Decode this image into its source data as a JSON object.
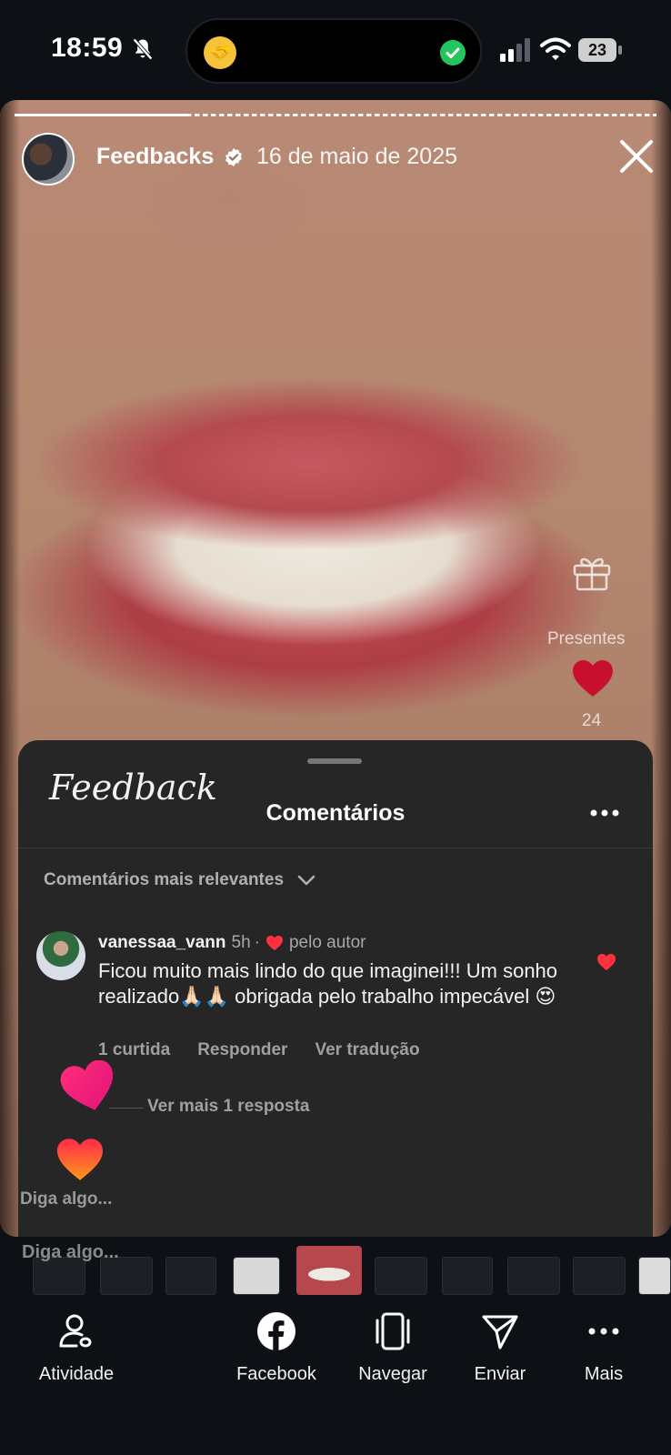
{
  "status_bar": {
    "time": "18:59",
    "battery": "23",
    "icons": [
      "bell-muted-icon",
      "handshake-emoji-icon",
      "check-circle-icon",
      "signal-icon",
      "wifi-icon",
      "battery-icon"
    ]
  },
  "story": {
    "account_name": "Feedbacks",
    "date": "16 de maio de 2025",
    "progress_fraction": 0.27,
    "gifts_label": "Presentes",
    "like_count": "24",
    "colors": {
      "heart": "#c8102e"
    }
  },
  "comments_sheet": {
    "script_title": "Feedback",
    "title": "Comentários",
    "sort_label": "Comentários mais relevantes",
    "comment": {
      "username": "vanessaa_vann",
      "time": "5h",
      "separator": "·",
      "author_like_label": "pelo autor",
      "text": "Ficou muito mais lindo do que imaginei!!! Um sonho realizado🙏🏻🙏🏻 obrigada pelo trabalho impecável 😍",
      "likes_label": "1 curtida",
      "reply_label": "Responder",
      "translate_label": "Ver tradução",
      "view_replies_label": "Ver mais 1 resposta"
    },
    "input_placeholder": "Diga algo...",
    "input_placeholder_behind": "Diga algo..."
  },
  "bottom_nav": {
    "items": [
      {
        "label": "Atividade",
        "icon": "activity-people-icon"
      },
      {
        "label": "Facebook",
        "icon": "facebook-icon"
      },
      {
        "label": "Navegar",
        "icon": "browse-cards-icon"
      },
      {
        "label": "Enviar",
        "icon": "send-paper-plane-icon"
      },
      {
        "label": "Mais",
        "icon": "more-dots-icon"
      }
    ]
  }
}
